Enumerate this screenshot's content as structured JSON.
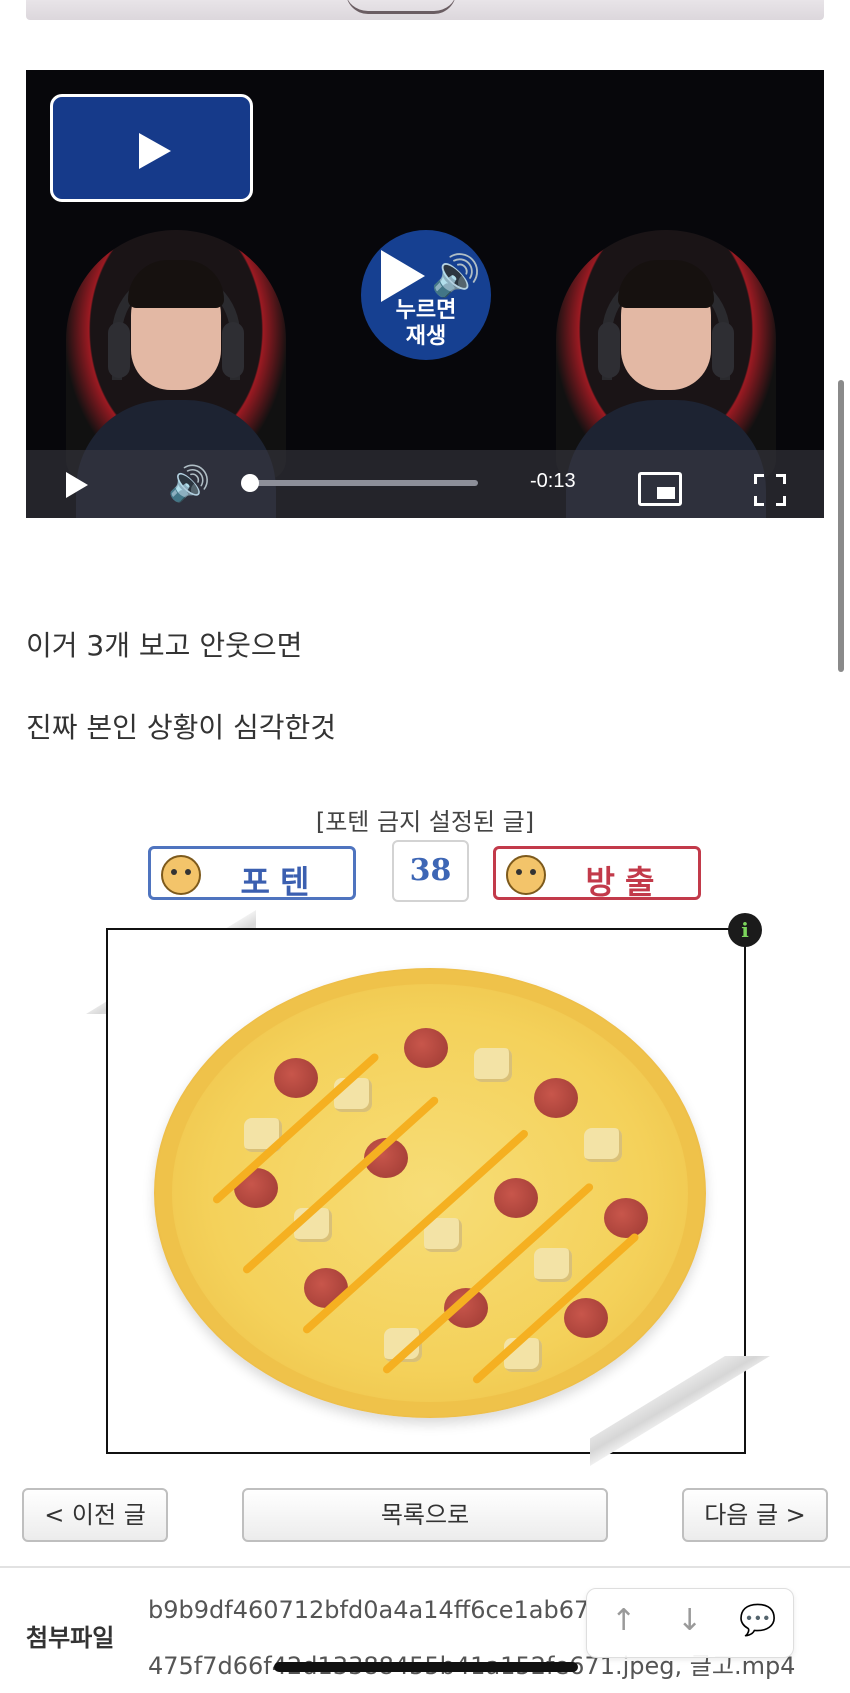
{
  "video": {
    "center_overlay_line1": "누르면",
    "center_overlay_line2": "재생",
    "time_remaining": "-0:13",
    "progress": 0
  },
  "post": {
    "line1": "이거 3개 보고 안웃으면",
    "line2": "진짜 본인 상황이 심각한것"
  },
  "votes": {
    "notice": "[포텐 금지 설정된 글]",
    "upvote_label": "포텐",
    "count": "38",
    "downvote_label": "방출"
  },
  "image": {
    "info_glyph": "i"
  },
  "nav": {
    "prev_label": "< 이전 글",
    "list_label": "목록으로",
    "next_label": "다음 글 >"
  },
  "attachments": {
    "label": "첨부파일",
    "file1": "b9b9df460712bfd0a4a14ff6ce1ab67",
    "file2": "475f7d66f42d13388455b41a152fe671.jpeg, 글고.mp4"
  },
  "floating": {
    "up": "↑",
    "down": "↓",
    "comment": "💬"
  },
  "icons": {
    "play": "play-icon",
    "volume": "volume-icon",
    "pip": "picture-in-picture-icon",
    "fullscreen": "fullscreen-icon",
    "info": "info-icon",
    "scroll_up": "arrow-up-icon",
    "scroll_down": "arrow-down-icon",
    "comment": "comment-icon"
  }
}
